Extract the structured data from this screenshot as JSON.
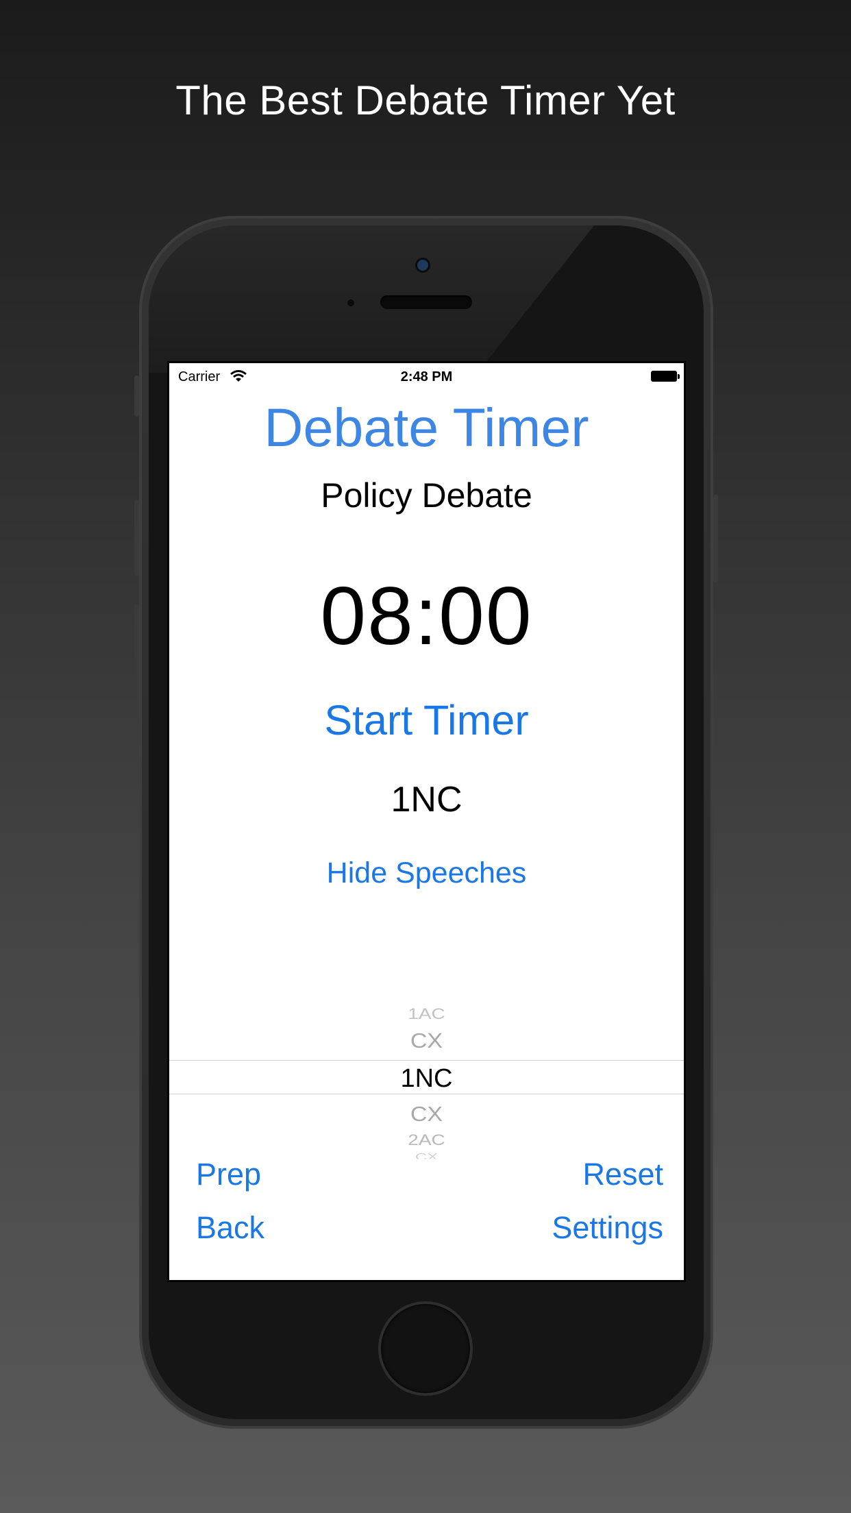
{
  "headline": "The Best Debate Timer Yet",
  "status_bar": {
    "carrier": "Carrier",
    "time": "2:48 PM"
  },
  "app": {
    "title": "Debate Timer",
    "mode": "Policy Debate",
    "timer": "08:00",
    "start_label": "Start Timer",
    "current_speech": "1NC",
    "hide_label": "Hide Speeches"
  },
  "picker": {
    "items": [
      "1AC",
      "CX",
      "1NC",
      "CX",
      "2AC",
      "CX"
    ],
    "selected": "1NC"
  },
  "buttons": {
    "prep": "Prep",
    "reset": "Reset",
    "back": "Back",
    "settings": "Settings"
  },
  "colors": {
    "accent": "#1a78e6",
    "title": "#3d86e3"
  }
}
